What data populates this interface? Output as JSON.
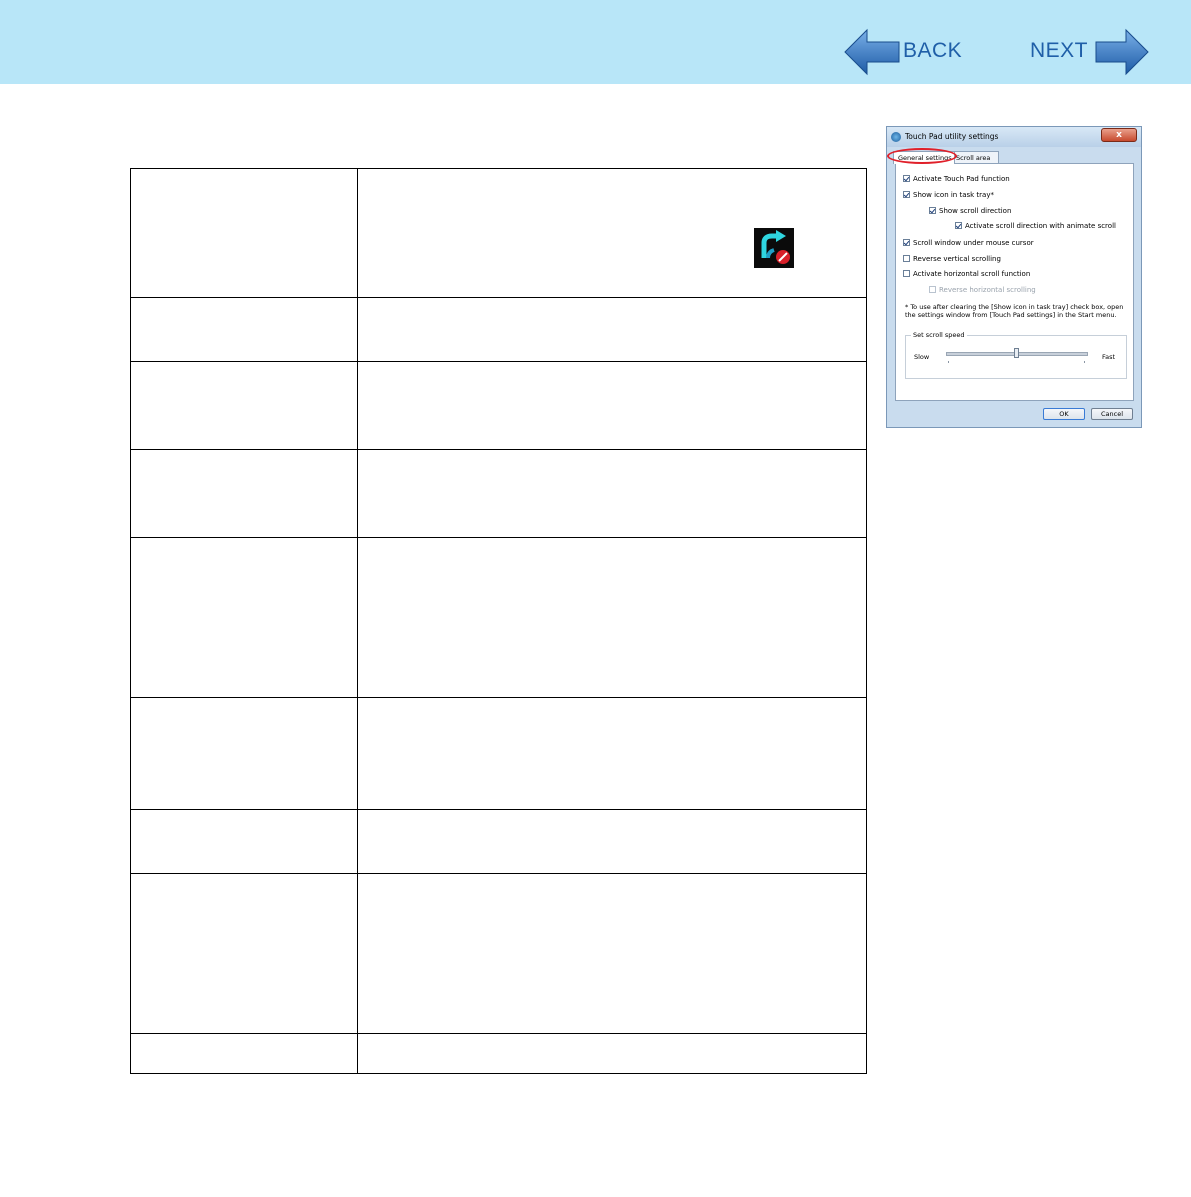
{
  "nav": {
    "back_label": "BACK",
    "next_label": "NEXT",
    "arrow_color": "#1f5fa8",
    "header_bg": "#b8e6f8"
  },
  "table": {
    "rows": [
      {
        "label": "",
        "text": ""
      },
      {
        "label": "",
        "text": ""
      },
      {
        "label": "",
        "text": ""
      },
      {
        "label": "",
        "text": ""
      },
      {
        "label": "",
        "text": ""
      },
      {
        "label": "",
        "text": ""
      },
      {
        "label": "",
        "text": ""
      },
      {
        "label": "",
        "text": ""
      },
      {
        "label": "",
        "text": ""
      }
    ],
    "tray_icon": "touch-pad-tray-icon"
  },
  "dialog": {
    "title": "Touch Pad utility settings",
    "close_label": "x",
    "tabs": [
      {
        "label": "General settings",
        "active": true
      },
      {
        "label": "Scroll area",
        "active": false
      }
    ],
    "checkboxes": [
      {
        "label": "Activate Touch Pad function",
        "checked": true,
        "disabled": false
      },
      {
        "label": "Show icon in task tray*",
        "checked": true,
        "disabled": false
      },
      {
        "label": "Show scroll direction",
        "checked": true,
        "disabled": false
      },
      {
        "label": "Activate scroll direction with animate scroll",
        "checked": true,
        "disabled": false
      },
      {
        "label": "Scroll window under mouse cursor",
        "checked": true,
        "disabled": false
      },
      {
        "label": "Reverse vertical scrolling",
        "checked": false,
        "disabled": false
      },
      {
        "label": "Activate horizontal scroll function",
        "checked": false,
        "disabled": false
      },
      {
        "label": "Reverse horizontal scrolling",
        "checked": false,
        "disabled": true
      }
    ],
    "note": "* To use after clearing the [Show icon in task tray] check box, open the settings window from [Touch Pad settings] in the Start menu.",
    "scroll_speed": {
      "title": "Set scroll speed",
      "slow_label": "Slow",
      "fast_label": "Fast",
      "value_fraction": 0.5
    },
    "ok_label": "OK",
    "cancel_label": "Cancel",
    "highlight_color": "#e0202a"
  }
}
